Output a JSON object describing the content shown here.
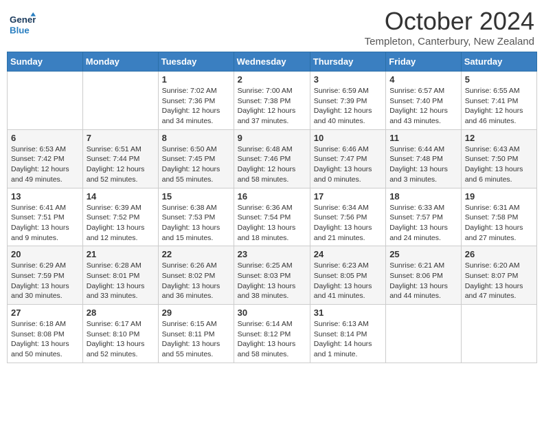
{
  "logo": {
    "line1": "General",
    "line2": "Blue"
  },
  "title": "October 2024",
  "location": "Templeton, Canterbury, New Zealand",
  "days_of_week": [
    "Sunday",
    "Monday",
    "Tuesday",
    "Wednesday",
    "Thursday",
    "Friday",
    "Saturday"
  ],
  "weeks": [
    [
      {
        "day": "",
        "info": ""
      },
      {
        "day": "",
        "info": ""
      },
      {
        "day": "1",
        "info": "Sunrise: 7:02 AM\nSunset: 7:36 PM\nDaylight: 12 hours and 34 minutes."
      },
      {
        "day": "2",
        "info": "Sunrise: 7:00 AM\nSunset: 7:38 PM\nDaylight: 12 hours and 37 minutes."
      },
      {
        "day": "3",
        "info": "Sunrise: 6:59 AM\nSunset: 7:39 PM\nDaylight: 12 hours and 40 minutes."
      },
      {
        "day": "4",
        "info": "Sunrise: 6:57 AM\nSunset: 7:40 PM\nDaylight: 12 hours and 43 minutes."
      },
      {
        "day": "5",
        "info": "Sunrise: 6:55 AM\nSunset: 7:41 PM\nDaylight: 12 hours and 46 minutes."
      }
    ],
    [
      {
        "day": "6",
        "info": "Sunrise: 6:53 AM\nSunset: 7:42 PM\nDaylight: 12 hours and 49 minutes."
      },
      {
        "day": "7",
        "info": "Sunrise: 6:51 AM\nSunset: 7:44 PM\nDaylight: 12 hours and 52 minutes."
      },
      {
        "day": "8",
        "info": "Sunrise: 6:50 AM\nSunset: 7:45 PM\nDaylight: 12 hours and 55 minutes."
      },
      {
        "day": "9",
        "info": "Sunrise: 6:48 AM\nSunset: 7:46 PM\nDaylight: 12 hours and 58 minutes."
      },
      {
        "day": "10",
        "info": "Sunrise: 6:46 AM\nSunset: 7:47 PM\nDaylight: 13 hours and 0 minutes."
      },
      {
        "day": "11",
        "info": "Sunrise: 6:44 AM\nSunset: 7:48 PM\nDaylight: 13 hours and 3 minutes."
      },
      {
        "day": "12",
        "info": "Sunrise: 6:43 AM\nSunset: 7:50 PM\nDaylight: 13 hours and 6 minutes."
      }
    ],
    [
      {
        "day": "13",
        "info": "Sunrise: 6:41 AM\nSunset: 7:51 PM\nDaylight: 13 hours and 9 minutes."
      },
      {
        "day": "14",
        "info": "Sunrise: 6:39 AM\nSunset: 7:52 PM\nDaylight: 13 hours and 12 minutes."
      },
      {
        "day": "15",
        "info": "Sunrise: 6:38 AM\nSunset: 7:53 PM\nDaylight: 13 hours and 15 minutes."
      },
      {
        "day": "16",
        "info": "Sunrise: 6:36 AM\nSunset: 7:54 PM\nDaylight: 13 hours and 18 minutes."
      },
      {
        "day": "17",
        "info": "Sunrise: 6:34 AM\nSunset: 7:56 PM\nDaylight: 13 hours and 21 minutes."
      },
      {
        "day": "18",
        "info": "Sunrise: 6:33 AM\nSunset: 7:57 PM\nDaylight: 13 hours and 24 minutes."
      },
      {
        "day": "19",
        "info": "Sunrise: 6:31 AM\nSunset: 7:58 PM\nDaylight: 13 hours and 27 minutes."
      }
    ],
    [
      {
        "day": "20",
        "info": "Sunrise: 6:29 AM\nSunset: 7:59 PM\nDaylight: 13 hours and 30 minutes."
      },
      {
        "day": "21",
        "info": "Sunrise: 6:28 AM\nSunset: 8:01 PM\nDaylight: 13 hours and 33 minutes."
      },
      {
        "day": "22",
        "info": "Sunrise: 6:26 AM\nSunset: 8:02 PM\nDaylight: 13 hours and 36 minutes."
      },
      {
        "day": "23",
        "info": "Sunrise: 6:25 AM\nSunset: 8:03 PM\nDaylight: 13 hours and 38 minutes."
      },
      {
        "day": "24",
        "info": "Sunrise: 6:23 AM\nSunset: 8:05 PM\nDaylight: 13 hours and 41 minutes."
      },
      {
        "day": "25",
        "info": "Sunrise: 6:21 AM\nSunset: 8:06 PM\nDaylight: 13 hours and 44 minutes."
      },
      {
        "day": "26",
        "info": "Sunrise: 6:20 AM\nSunset: 8:07 PM\nDaylight: 13 hours and 47 minutes."
      }
    ],
    [
      {
        "day": "27",
        "info": "Sunrise: 6:18 AM\nSunset: 8:08 PM\nDaylight: 13 hours and 50 minutes."
      },
      {
        "day": "28",
        "info": "Sunrise: 6:17 AM\nSunset: 8:10 PM\nDaylight: 13 hours and 52 minutes."
      },
      {
        "day": "29",
        "info": "Sunrise: 6:15 AM\nSunset: 8:11 PM\nDaylight: 13 hours and 55 minutes."
      },
      {
        "day": "30",
        "info": "Sunrise: 6:14 AM\nSunset: 8:12 PM\nDaylight: 13 hours and 58 minutes."
      },
      {
        "day": "31",
        "info": "Sunrise: 6:13 AM\nSunset: 8:14 PM\nDaylight: 14 hours and 1 minute."
      },
      {
        "day": "",
        "info": ""
      },
      {
        "day": "",
        "info": ""
      }
    ]
  ]
}
